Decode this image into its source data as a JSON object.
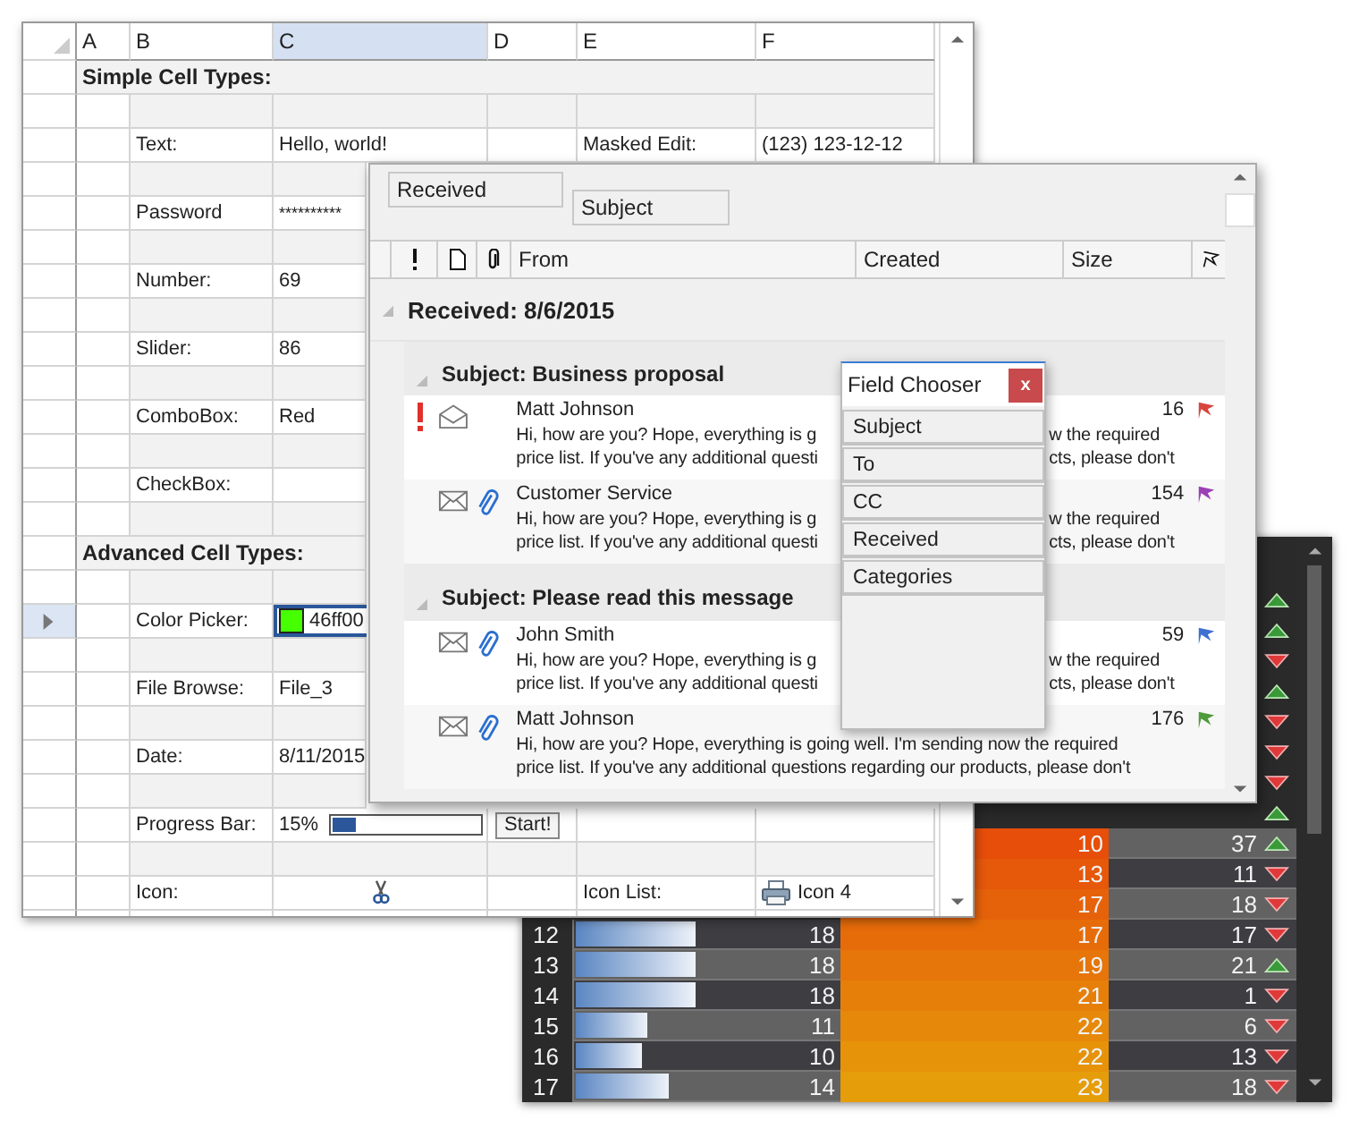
{
  "spreadsheet": {
    "columns": [
      {
        "label": "A",
        "selected": false
      },
      {
        "label": "B",
        "selected": false
      },
      {
        "label": "C",
        "selected": true
      },
      {
        "label": "D",
        "selected": false
      },
      {
        "label": "E",
        "selected": false
      },
      {
        "label": "F",
        "selected": false
      }
    ],
    "rows": [
      {
        "kind": "section",
        "title": "Simple Cell Types:",
        "selected": false
      },
      {
        "kind": "blank",
        "selected": false
      },
      {
        "kind": "field",
        "label": "Text:",
        "value": "Hello, world!",
        "extra_label": "Masked Edit:",
        "extra_value": "(123) 123-12-12",
        "selected": false
      },
      {
        "kind": "blank",
        "selected": false
      },
      {
        "kind": "password",
        "label": "Password",
        "value": "**********",
        "selected": false
      },
      {
        "kind": "blank",
        "selected": false
      },
      {
        "kind": "field",
        "label": "Number:",
        "value": "69",
        "selected": false
      },
      {
        "kind": "blank",
        "selected": false
      },
      {
        "kind": "field",
        "label": "Slider:",
        "value": "86",
        "selected": false
      },
      {
        "kind": "blank",
        "selected": false
      },
      {
        "kind": "field",
        "label": "ComboBox:",
        "value": "Red",
        "selected": false
      },
      {
        "kind": "blank",
        "selected": false
      },
      {
        "kind": "field",
        "label": "CheckBox:",
        "selected": false
      },
      {
        "kind": "blank",
        "selected": false
      },
      {
        "kind": "section",
        "title": "Advanced Cell Types:",
        "selected": false
      },
      {
        "kind": "blank",
        "selected": false
      },
      {
        "kind": "color",
        "label": "Color Picker:",
        "value": "46ff00",
        "color": "#46ff00",
        "selected": true
      },
      {
        "kind": "blank",
        "selected": false
      },
      {
        "kind": "field",
        "label": "File Browse:",
        "value": "File_3",
        "selected": false
      },
      {
        "kind": "blank",
        "selected": false
      },
      {
        "kind": "field",
        "label": "Date:",
        "value": "8/11/2015",
        "selected": false
      },
      {
        "kind": "blank",
        "selected": false
      },
      {
        "kind": "progress",
        "label": "Progress Bar:",
        "value": "15%",
        "level": 0.15,
        "button": "Start!",
        "selected": false
      },
      {
        "kind": "blank",
        "selected": false
      },
      {
        "kind": "icon",
        "label": "Icon:",
        "extra_label": "Icon List:",
        "extra_value": "Icon 4",
        "selected": false
      }
    ]
  },
  "mail": {
    "group_by": [
      "Received",
      "Subject"
    ],
    "columns": [
      "From",
      "Created",
      "Size"
    ],
    "groups": [
      {
        "title": "Received: 8/6/2015",
        "expanded": true,
        "subgroups": [
          {
            "title": "Subject: Business proposal",
            "expanded": true,
            "messages": [
              {
                "from": "Matt Johnson",
                "body": [
                  "Hi, how are you? Hope, everything is g\nprice list. If you've any additional questi",
                  "w the required\ncts, please don't"
                ],
                "size": "16",
                "important": true,
                "read": true,
                "attachment": false,
                "color": "#d9443f"
              },
              {
                "from": "Customer Service",
                "body": [
                  "Hi, how are you? Hope, everything is g\nprice list. If you've any additional questi",
                  "w the required\ncts, please don't"
                ],
                "size": "154",
                "important": false,
                "read": false,
                "attachment": true,
                "color": "#9b3fb5"
              }
            ]
          },
          {
            "title": "Subject: Please read this message",
            "expanded": true,
            "messages": [
              {
                "from": "John Smith",
                "body": [
                  "Hi, how are you? Hope, everything is g\nprice list. If you've any additional questi",
                  "w the required\ncts, please don't"
                ],
                "size": "59",
                "important": false,
                "read": false,
                "attachment": true,
                "color": "#3f6fd0"
              },
              {
                "from": "Matt Johnson",
                "body": [
                  "Hi, how are you? Hope, everything is going well. I'm sending now the required\nprice list. If you've any additional questions regarding our products, please don't"
                ],
                "size": "176",
                "important": false,
                "read": false,
                "attachment": true,
                "color": "#4f9a3a"
              }
            ]
          }
        ]
      }
    ]
  },
  "field_chooser": {
    "title": "Field Chooser",
    "close": "x",
    "fields": [
      "Subject",
      "To",
      "CC",
      "Received",
      "Categories"
    ]
  },
  "grid": {
    "rows": [
      {
        "rising": true
      },
      {
        "rising": true
      },
      {
        "rising": false
      },
      {
        "rising": true
      },
      {
        "rising": false
      },
      {
        "rising": false
      },
      {
        "rising": false
      },
      {
        "rising": true
      },
      {
        "heat": "10",
        "change": "37",
        "rising": true
      },
      {
        "heat": "13",
        "change": "11",
        "rising": false
      },
      {
        "heat": "17",
        "change": "18",
        "rising": false
      },
      {
        "number": "12",
        "bar": "18",
        "level": 0.45,
        "heat": "17",
        "change": "17",
        "rising": false
      },
      {
        "number": "13",
        "bar": "18",
        "level": 0.45,
        "heat": "19",
        "change": "21",
        "rising": true
      },
      {
        "number": "14",
        "bar": "18",
        "level": 0.45,
        "heat": "21",
        "change": "1",
        "rising": false
      },
      {
        "number": "15",
        "bar": "11",
        "level": 0.27,
        "heat": "22",
        "change": "6",
        "rising": false
      },
      {
        "number": "16",
        "bar": "10",
        "level": 0.25,
        "heat": "22",
        "change": "13",
        "rising": false
      },
      {
        "number": "17",
        "bar": "14",
        "level": 0.35,
        "heat": "23",
        "change": "18",
        "rising": false
      }
    ]
  }
}
